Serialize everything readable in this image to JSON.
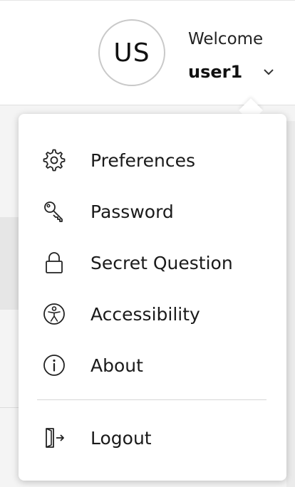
{
  "header": {
    "avatar_initials": "US",
    "welcome_label": "Welcome",
    "username": "user1"
  },
  "menu": {
    "items": [
      {
        "label": "Preferences",
        "icon": "gear-icon"
      },
      {
        "label": "Password",
        "icon": "key-icon"
      },
      {
        "label": "Secret Question",
        "icon": "lock-icon"
      },
      {
        "label": "Accessibility",
        "icon": "accessibility-icon"
      },
      {
        "label": "About",
        "icon": "info-icon"
      }
    ],
    "logout": {
      "label": "Logout",
      "icon": "logout-icon"
    }
  }
}
